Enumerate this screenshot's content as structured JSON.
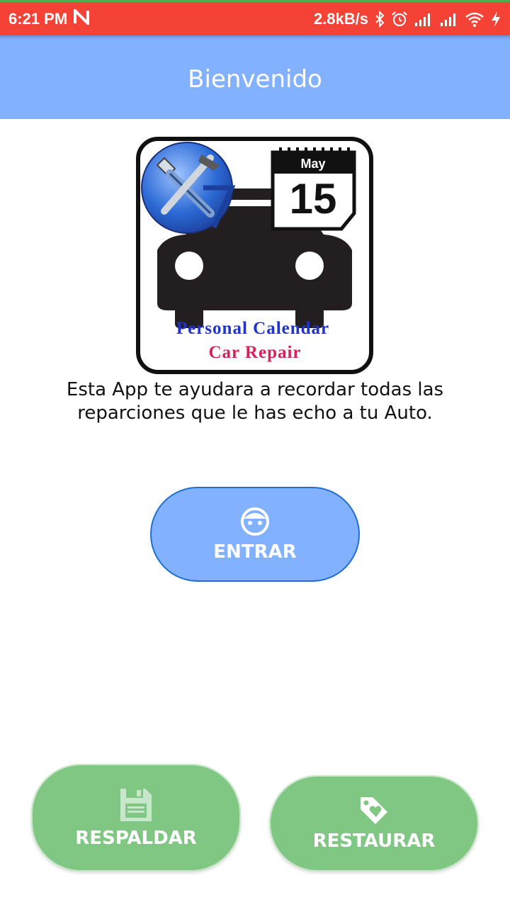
{
  "status_bar": {
    "time": "6:21 PM",
    "network_speed": "2.8kB/s",
    "background_color": "#f44336",
    "icons": [
      "n-notification-icon",
      "bluetooth-icon",
      "alarm-icon",
      "signal-icon",
      "signal-icon",
      "wifi-icon",
      "charging-icon"
    ]
  },
  "app_bar": {
    "title": "Bienvenido",
    "background_color": "#82b1ff"
  },
  "logo": {
    "calendar_month": "May",
    "calendar_day": "15",
    "line1": "Personal Calendar",
    "line2": "Car Repair"
  },
  "description": "Esta App te ayudara a recordar todas las reparciones que le has echo a tu Auto.",
  "buttons": {
    "entrar": {
      "label": "ENTRAR",
      "icon": "face-icon",
      "color": "#82b1ff"
    },
    "respaldar": {
      "label": "RESPALDAR",
      "icon": "save-icon",
      "color": "#81c784"
    },
    "restaurar": {
      "label": "RESTAURAR",
      "icon": "tag-heart-icon",
      "color": "#81c784"
    }
  }
}
